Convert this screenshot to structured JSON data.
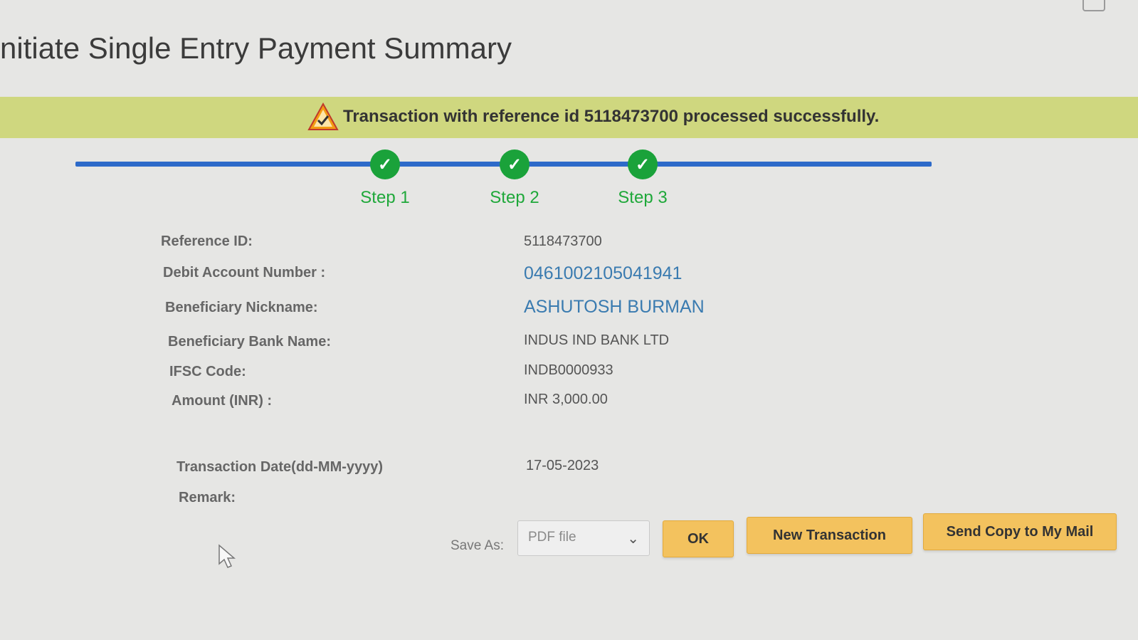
{
  "page": {
    "title": "nitiate Single Entry Payment Summary"
  },
  "banner": {
    "message": "Transaction with reference id 5118473700 processed successfully.",
    "icon": "warning-check-icon",
    "color": "#cfd77f"
  },
  "steps": [
    {
      "label": "Step 1",
      "status": "completed"
    },
    {
      "label": "Step 2",
      "status": "completed"
    },
    {
      "label": "Step 3",
      "status": "completed"
    }
  ],
  "details": [
    {
      "label": "Reference ID:",
      "value": "5118473700"
    },
    {
      "label": "Debit Account Number :",
      "value": "0461002105041941"
    },
    {
      "label": "Beneficiary Nickname:",
      "value": "ASHUTOSH BURMAN"
    },
    {
      "label": "Beneficiary Bank Name:",
      "value": "INDUS IND BANK LTD"
    },
    {
      "label": "IFSC Code:",
      "value": "INDB0000933"
    },
    {
      "label": "Amount (INR) :",
      "value": "INR 3,000.00"
    },
    {
      "label": "Transaction Date(dd-MM-yyyy)",
      "value": "17-05-2023"
    },
    {
      "label": "Remark:",
      "value": ""
    }
  ],
  "footer": {
    "save_as_label": "Save As:",
    "save_as_selected": "PDF file",
    "ok_label": "OK",
    "new_transaction_label": "New Transaction",
    "send_copy_label": "Send Copy to My Mail"
  },
  "colors": {
    "accent_blue": "#2d6ac9",
    "step_green": "#1aa23a",
    "button_orange": "#f3c25e"
  }
}
